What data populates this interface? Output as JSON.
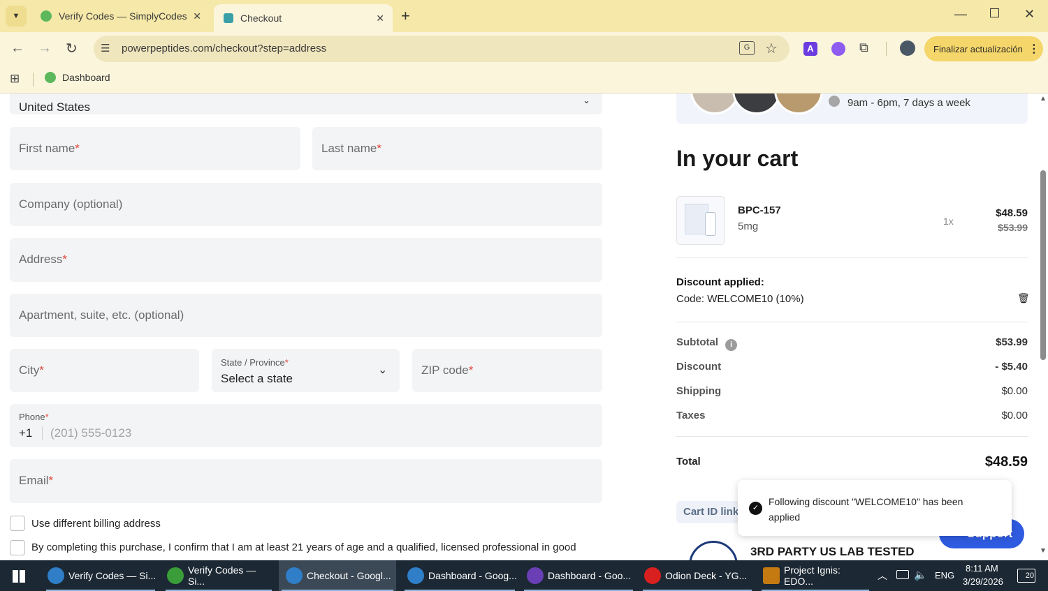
{
  "browser": {
    "tabs": [
      {
        "title": "Verify Codes — SimplyCodes",
        "active": false
      },
      {
        "title": "Checkout",
        "active": true
      }
    ],
    "url": "powerpeptides.com/checkout?step=address",
    "update_button": "Finalizar actualización",
    "bookmarks": [
      {
        "label": "Dashboard"
      }
    ]
  },
  "form": {
    "country_value": "United States",
    "first_name": "First name",
    "last_name": "Last name",
    "company": "Company (optional)",
    "address": "Address",
    "apartment": "Apartment, suite, etc. (optional)",
    "city": "City",
    "state_label": "State / Province",
    "state_value": "Select a state",
    "zip": "ZIP code",
    "phone_label": "Phone",
    "phone_prefix": "+1",
    "phone_placeholder": "(201) 555-0123",
    "email": "Email",
    "required_mark": "*",
    "billing_checkbox": "Use different billing address",
    "consent_text": "By completing this purchase, I confirm that I am at least 21 years of age and a qualified, licensed professional in good"
  },
  "support_box": {
    "hours": "9am - 6pm, 7 days a week"
  },
  "cart": {
    "title": "In your cart",
    "items": [
      {
        "name": "BPC-157",
        "variant": "5mg",
        "qty": "1x",
        "price": "$48.59",
        "old_price": "$53.99"
      }
    ],
    "discount_label": "Discount applied:",
    "discount_code": "Code: WELCOME10 (10%)",
    "subtotal_label": "Subtotal",
    "subtotal": "$53.99",
    "discount_row_label": "Discount",
    "discount_value": "- $5.40",
    "shipping_label": "Shipping",
    "shipping_value": "$0.00",
    "taxes_label": "Taxes",
    "taxes_value": "$0.00",
    "total_label": "Total",
    "total_value": "$48.59",
    "cart_id_link": "Cart ID link",
    "lab_tested": "3RD PARTY US LAB TESTED",
    "support_button": "Support"
  },
  "toast": {
    "message": "Following discount \"WELCOME10\" has been applied"
  },
  "taskbar": {
    "items": [
      {
        "label": "Verify Codes — Si...",
        "color": "#2f7ec7"
      },
      {
        "label": "Verify Codes — Si...",
        "color": "#3a9d3a"
      },
      {
        "label": "Checkout - Googl...",
        "color": "#2f7ec7"
      },
      {
        "label": "Dashboard - Goog...",
        "color": "#2f7ec7"
      },
      {
        "label": "Dashboard - Goo...",
        "color": "#6a3fb5"
      },
      {
        "label": "Odion Deck - YG...",
        "color": "#d8201f"
      },
      {
        "label": "Project Ignis: EDO...",
        "color": "#c47a10"
      }
    ],
    "lang": "ENG",
    "time": "8:11 AM",
    "date": "3/29/2026",
    "notifications": "20"
  }
}
